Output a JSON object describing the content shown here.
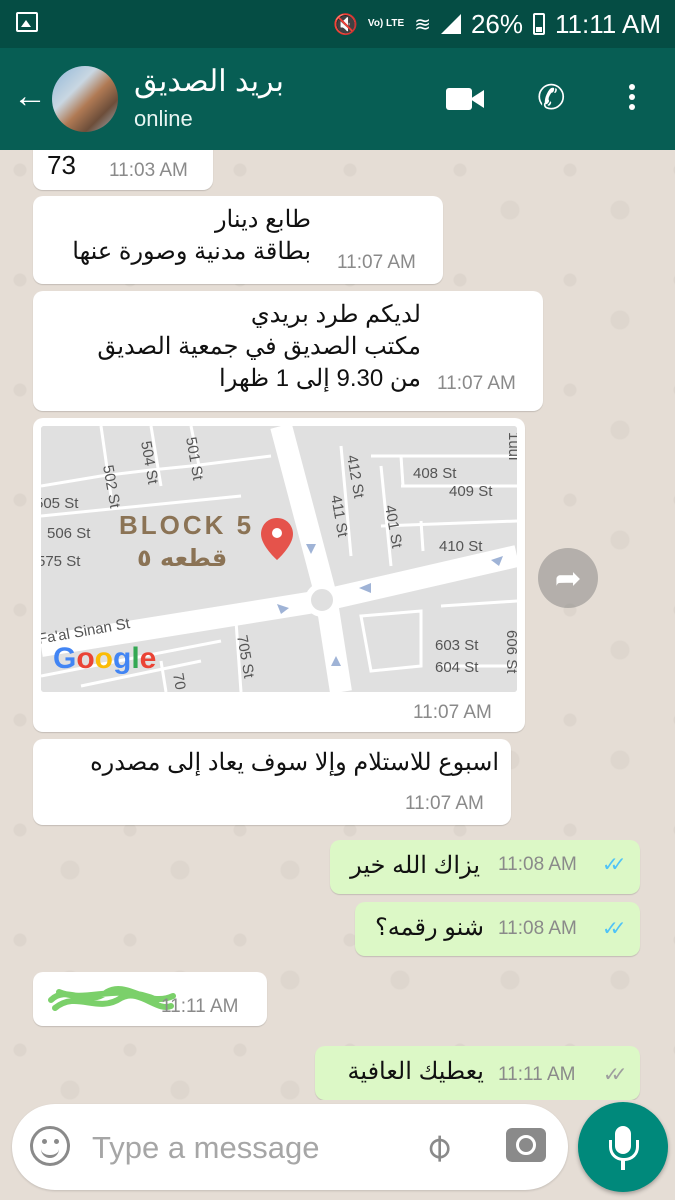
{
  "status_bar": {
    "battery": "26%",
    "time": "11:11 AM",
    "lte_label": "Vo) LTE"
  },
  "header": {
    "contact_name": "بريد الصديق",
    "status": "online"
  },
  "messages": [
    {
      "id": "m1",
      "text": "73",
      "time": "11:03 AM"
    },
    {
      "id": "m2",
      "lines": [
        "طابع دينار",
        "بطاقة مدنية وصورة عنها"
      ],
      "time": "11:07 AM"
    },
    {
      "id": "m3",
      "lines": [
        "لديكم طرد بريدي",
        "مكتب الصديق في جمعية الصديق",
        "من 9.30 إلى 1 ظهرا"
      ],
      "time": "11:07 AM"
    },
    {
      "id": "m4",
      "type": "location",
      "time": "11:07 AM",
      "map": {
        "block_en": "BLOCK 5",
        "block_ar": "قطعه ٥",
        "streets": [
          "502 St",
          "504 St",
          "501 St",
          "505 St",
          "506 St",
          "575 St",
          "412 St",
          "411 St",
          "401 St",
          "408 St",
          "409 St",
          "410 St",
          "Fa'al Sinan St",
          "705 St",
          "603 St",
          "604 St",
          "70",
          "606 St",
          "1uui"
        ],
        "brand": "Google"
      }
    },
    {
      "id": "m5",
      "text": "اسبوع للاستلام وإلا سوف يعاد إلى مصدره",
      "time": "11:07 AM"
    },
    {
      "id": "m6",
      "text": "يزاك الله خير",
      "time": "11:08 AM",
      "outgoing": true,
      "read": true
    },
    {
      "id": "m7",
      "text": "شنو رقمه؟",
      "time": "11:08 AM",
      "outgoing": true,
      "read": true
    },
    {
      "id": "m8",
      "redacted": true,
      "time": "11:11 AM"
    },
    {
      "id": "m9",
      "text": "يعطيك العافية",
      "time": "11:11 AM",
      "outgoing": true,
      "read": false
    }
  ],
  "input": {
    "placeholder": "Type a message"
  },
  "colors": {
    "header": "#075e54",
    "status_bar": "#054d44",
    "outgoing": "#dcf8c6",
    "read_ticks": "#4fc3f7",
    "mic": "#00897b"
  },
  "icons": [
    "gallery-icon",
    "mute-icon",
    "wifi-icon",
    "signal-icon",
    "battery-icon",
    "back-arrow-icon",
    "video-call-icon",
    "phone-icon",
    "more-icon",
    "forward-icon",
    "location-pin-icon",
    "emoji-icon",
    "attach-icon",
    "camera-icon",
    "mic-icon"
  ]
}
